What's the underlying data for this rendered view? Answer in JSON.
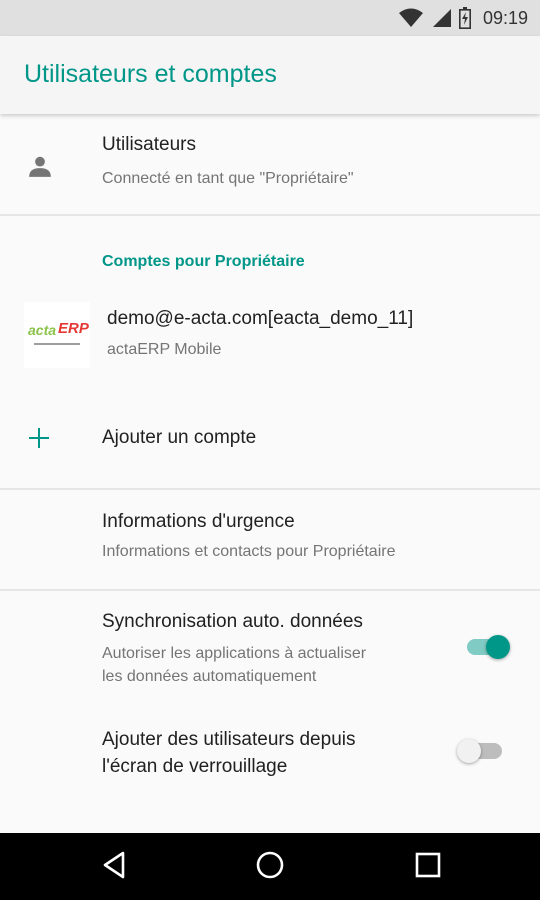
{
  "status_bar": {
    "time": "09:19",
    "icons": [
      "wifi-icon",
      "cell-signal-icon",
      "battery-icon"
    ]
  },
  "app_bar": {
    "title": "Utilisateurs et comptes"
  },
  "users": {
    "icon": "person-icon",
    "title": "Utilisateurs",
    "subtitle": "Connecté en tant que \"Propriétaire\""
  },
  "accounts_section": {
    "header": "Comptes pour Propriétaire",
    "account": {
      "logo_text_1": "acta",
      "logo_text_2": "ERP",
      "email": "demo@e-acta.com[eacta_demo_11]",
      "app": "actaERP Mobile"
    },
    "add_account": {
      "icon": "plus-icon",
      "label": "Ajouter un compte"
    }
  },
  "emergency": {
    "title": "Informations d'urgence",
    "subtitle": "Informations et contacts pour Propriétaire"
  },
  "auto_sync": {
    "title": "Synchronisation auto. données",
    "subtitle_line1": "Autoriser les applications à actualiser",
    "subtitle_line2": "les données automatiquement",
    "enabled": true
  },
  "lock_screen_users": {
    "title_line1": "Ajouter des utilisateurs depuis",
    "title_line2": "l'écran de verrouillage",
    "enabled": false
  },
  "nav_bar": {
    "buttons": [
      "back-icon",
      "home-icon",
      "recents-icon"
    ]
  },
  "colors": {
    "accent": "#009688",
    "toggle_on_track": "#80cbc4",
    "toggle_off_track": "#bdbdbd",
    "toggle_off_thumb": "#f1f1f1"
  }
}
